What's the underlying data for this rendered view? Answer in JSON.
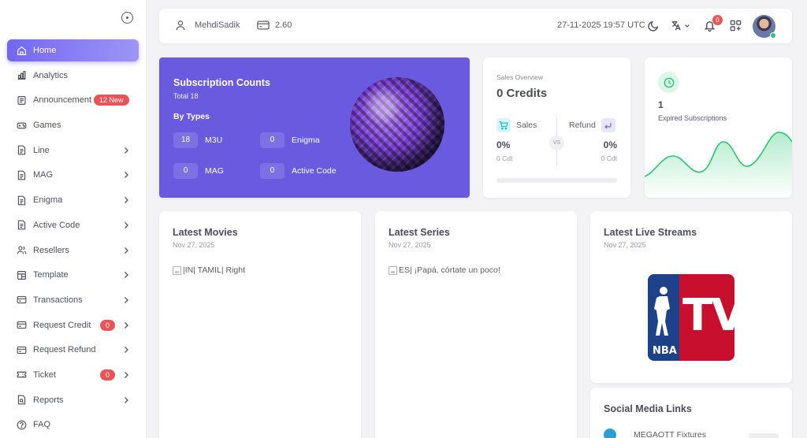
{
  "sidebar": {
    "items": [
      {
        "label": "Home",
        "icon": "home-icon",
        "active": true
      },
      {
        "label": "Analytics",
        "icon": "chart-icon"
      },
      {
        "label": "Announcement",
        "icon": "document-icon",
        "badge": "12 New"
      },
      {
        "label": "Games",
        "icon": "gamepad-icon"
      },
      {
        "label": "Line",
        "icon": "file-icon",
        "chevron": true
      },
      {
        "label": "MAG",
        "icon": "file-icon",
        "chevron": true
      },
      {
        "label": "Enigma",
        "icon": "file-icon",
        "chevron": true
      },
      {
        "label": "Active Code",
        "icon": "file-icon",
        "chevron": true
      },
      {
        "label": "Resellers",
        "icon": "users-icon",
        "chevron": true
      },
      {
        "label": "Template",
        "icon": "template-icon",
        "chevron": true
      },
      {
        "label": "Transactions",
        "icon": "card-icon",
        "chevron": true
      },
      {
        "label": "Request Credit",
        "icon": "card-icon",
        "badge": "0",
        "chevron": true
      },
      {
        "label": "Request Refund",
        "icon": "card-icon",
        "chevron": true
      },
      {
        "label": "Ticket",
        "icon": "ticket-icon",
        "badge": "0",
        "chevron": true
      },
      {
        "label": "Reports",
        "icon": "report-icon",
        "chevron": true
      },
      {
        "label": "FAQ",
        "icon": "help-icon"
      }
    ]
  },
  "topbar": {
    "username": "MehdiSadik",
    "credits": "2.60",
    "datetime": "27-11-2025 19:57 UTC",
    "notification_count": "0"
  },
  "subscription": {
    "title": "Subscription Counts",
    "total": "Total 18",
    "by_types_label": "By Types",
    "types": [
      {
        "count": "18",
        "label": "M3U"
      },
      {
        "count": "0",
        "label": "Enigma"
      },
      {
        "count": "0",
        "label": "MAG"
      },
      {
        "count": "0",
        "label": "Active Code"
      }
    ]
  },
  "sales_overview": {
    "label": "Sales Overview",
    "credits": "0 Credits",
    "sales_label": "Sales",
    "refund_label": "Refund",
    "vs": "VS",
    "sales_pct": "0%",
    "refund_pct": "0%",
    "sales_cdt": "0 Cdt",
    "refund_cdt": "0 Cdt",
    "progress": 0
  },
  "expired": {
    "count": "1",
    "label": "Expired Subscriptions"
  },
  "latest_movies": {
    "title": "Latest Movies",
    "date": "Nov 27, 2025",
    "item": "|IN| TAMIL| Right"
  },
  "latest_series": {
    "title": "Latest Series",
    "date": "Nov 27, 2025",
    "item": "ES| ¡Papá, córtate un poco!"
  },
  "latest_live": {
    "title": "Latest Live Streams",
    "date": "Nov 27, 2025",
    "logo_text": "NBA",
    "logo_tv": "TV"
  },
  "social": {
    "title": "Social Media Links",
    "item": "MEGAOTT Fixtures"
  },
  "colors": {
    "accent": "#7367f0",
    "card_purple": "#6a5ae0",
    "danger": "#ea5455",
    "success": "#28c76f"
  }
}
